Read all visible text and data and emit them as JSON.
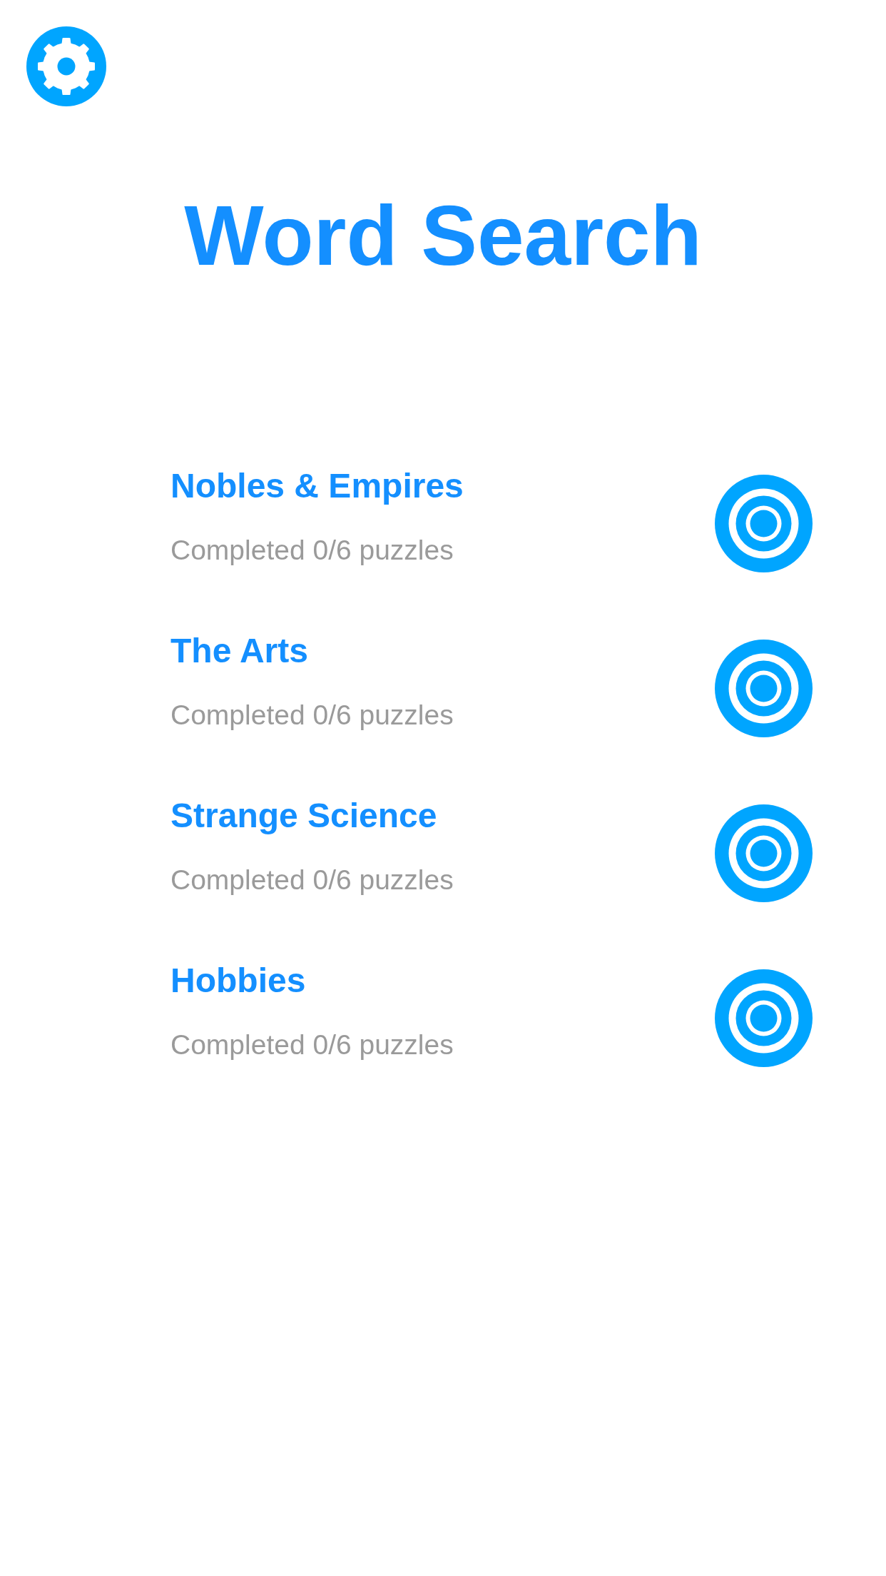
{
  "title": "Word Search",
  "categories": [
    {
      "title": "Nobles & Empires",
      "progress": "Completed 0/6 puzzles"
    },
    {
      "title": "The Arts",
      "progress": "Completed 0/6 puzzles"
    },
    {
      "title": "Strange Science",
      "progress": "Completed 0/6 puzzles"
    },
    {
      "title": "Hobbies",
      "progress": "Completed 0/6 puzzles"
    }
  ]
}
